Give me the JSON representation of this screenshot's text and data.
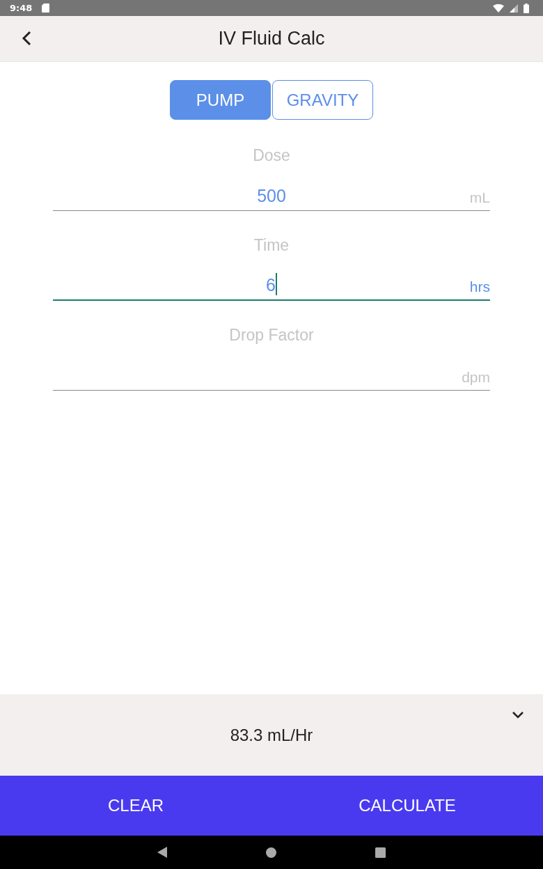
{
  "status_bar": {
    "time": "9:48"
  },
  "header": {
    "title": "IV Fluid Calc"
  },
  "tabs": [
    {
      "label": "PUMP",
      "selected": true
    },
    {
      "label": "GRAVITY",
      "selected": false
    }
  ],
  "fields": [
    {
      "label": "Dose",
      "value": "500",
      "unit": "mL",
      "focused": false
    },
    {
      "label": "Time",
      "value": "6",
      "unit": "hrs",
      "focused": true
    },
    {
      "label": "Drop Factor",
      "unit": "dpm",
      "focused": false
    }
  ],
  "result": {
    "text": "83.3 mL/Hr",
    "expanded": false
  },
  "buttons": [
    {
      "label": "CLEAR"
    },
    {
      "label": "CALCULATE"
    }
  ]
}
